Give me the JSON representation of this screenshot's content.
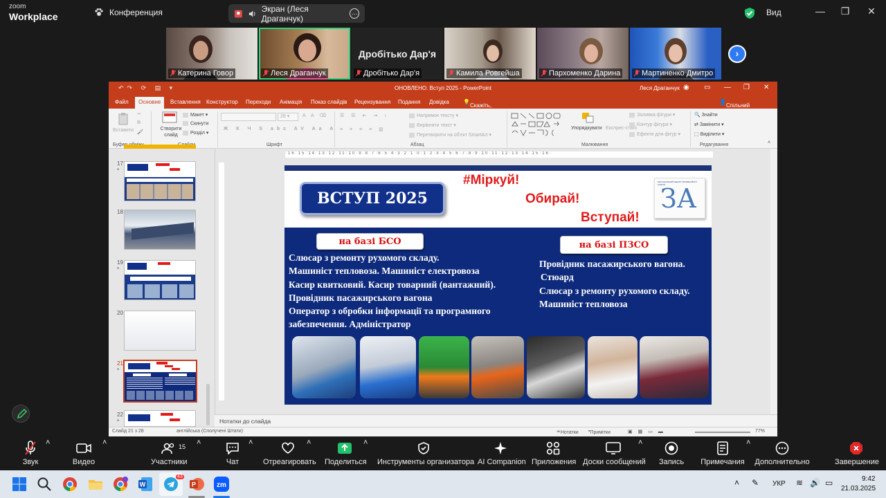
{
  "zoom": {
    "logo_small": "zoom",
    "logo_big": "Workplace",
    "meeting_title": "Конференция",
    "share_status": "Экран (Леся Драганчук)",
    "view_label": "Вид"
  },
  "participants": [
    {
      "name": "Катерина Говор"
    },
    {
      "name": "Леся Драганчук",
      "active": true
    },
    {
      "name": "Дробітько Дар'я",
      "display_name": "Дробітько Дар'я"
    },
    {
      "name": "Камила Ровгейша"
    },
    {
      "name": "Пархоменко Дарина"
    },
    {
      "name": "Мартиненко Дмитро"
    }
  ],
  "ppt": {
    "title": "ОНОВЛЕНО. Вступ 2025 - PowerPoint",
    "user": "Леся Драганчук",
    "tabs": [
      "Файл",
      "Основне",
      "Вставлення",
      "Конструктор",
      "Переходи",
      "Анімація",
      "Показ слайдів",
      "Рецензування",
      "Подання",
      "Довідка",
      "Скажіть, що потрібно зробити",
      "Спільний доступ"
    ],
    "ribbon": {
      "paste": "Вставити",
      "clipboard": "Буфер обміну",
      "new_slide": "Створити слайд",
      "layout": "Макет",
      "reset": "Скинути",
      "section": "Розділ",
      "slides_group": "Слайди",
      "font_group": "Шрифт",
      "paragraph_group": "Абзац",
      "text_direction": "Напрямок тексту",
      "align_text": "Вирівняти текст",
      "smartart": "Перетворити на об'єкт SmartArt",
      "arrange": "Упорядкувати",
      "quick_styles": "Експрес-стилі",
      "drawing_group": "Малювання",
      "shape_fill": "Заливка фігури",
      "shape_outline": "Контур фігури",
      "shape_effects": "Ефекти для фігур",
      "find": "Знайти",
      "replace": "Замінити",
      "select": "Виділити",
      "editing_group": "Редагування"
    },
    "thumbnails": [
      {
        "num": "17",
        "star": "*"
      },
      {
        "num": "18",
        "star": ""
      },
      {
        "num": "19",
        "star": "*"
      },
      {
        "num": "20",
        "star": ""
      },
      {
        "num": "21",
        "star": "*",
        "selected": true
      },
      {
        "num": "22",
        "star": "*"
      }
    ],
    "slide": {
      "badge": "ВСТУП 2025",
      "hashtag": "#Міркуй!",
      "choose": "Обирай!",
      "enter": "Вступай!",
      "logo_caption": "РЕГІОНАЛЬНИЙ ЦЕНТР ПРОФЕСІЙНОЇ ОСВІТИ",
      "logo_letters": "ЗА",
      "left_pill": "на базі БСО",
      "right_pill": "на базі ПЗСО",
      "left_lines": [
        "Слюсар з ремонту рухомого складу.",
        "Машиніст тепловоза. Машиніст електровоза",
        "Касир квитковий. Касир товарний (вантажний).",
        "Провідник пасажирського вагона",
        "Оператор з обробки інформації  та програмного",
        "забезпечення. Адміністратор"
      ],
      "right_lines": [
        "Провідник пасажирського вагона.",
        "Стюард",
        "Слюсар з ремонту рухомого складу.",
        "Машиніст тепловоза"
      ]
    },
    "notes_placeholder": "Нотатки до слайда",
    "status": {
      "slide_count": "Слайд 21 з 28",
      "language": "англійська (Сполучені Штати)",
      "notes": "Нотатки",
      "comments": "Примітки",
      "zoom": "77%"
    }
  },
  "toolbar": [
    {
      "label": "Звук",
      "icon": "mic-off-icon"
    },
    {
      "label": "Видео",
      "icon": "video-icon"
    },
    {
      "label": "Участники",
      "icon": "participants-icon",
      "count": "15"
    },
    {
      "label": "Чат",
      "icon": "chat-icon"
    },
    {
      "label": "Отреагировать",
      "icon": "heart-icon"
    },
    {
      "label": "Поделиться",
      "icon": "share-icon"
    },
    {
      "label": "Инструменты организатора",
      "icon": "shield-icon"
    },
    {
      "label": "AI Companion",
      "icon": "sparkle-icon"
    },
    {
      "label": "Приложения",
      "icon": "apps-icon"
    },
    {
      "label": "Доски сообщений",
      "icon": "whiteboard-icon"
    },
    {
      "label": "Запись",
      "icon": "record-icon"
    },
    {
      "label": "Примечания",
      "icon": "notes-icon"
    },
    {
      "label": "Дополнительно",
      "icon": "more-icon"
    },
    {
      "label": "Завершение",
      "icon": "end-icon"
    }
  ],
  "taskbar": {
    "lang": "УКР",
    "time": "9:42",
    "date": "21.03.2025",
    "telegram_badge": "43"
  },
  "colors": {
    "ppt_accent": "#c43e1c",
    "slide_blue": "#0e2a7c",
    "zoom_share_green": "#23c16b",
    "end_red": "#e02828"
  }
}
